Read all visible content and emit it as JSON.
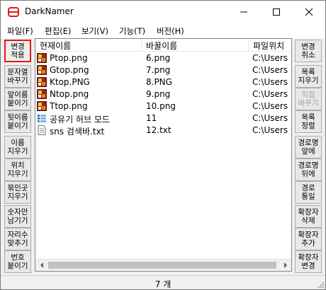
{
  "window": {
    "title": "DarkNamer"
  },
  "menu": [
    {
      "label": "파일(F)"
    },
    {
      "label": "편집(E)"
    },
    {
      "label": "보기(V)"
    },
    {
      "label": "기능(T)"
    },
    {
      "label": "버전(H)"
    }
  ],
  "left_buttons": [
    {
      "label": "변경\n적용"
    },
    {
      "label": "문자열\n바꾸기"
    },
    {
      "label": "앞이름\n붙이기"
    },
    {
      "label": "뒷이름\n붙이기"
    },
    {
      "label": "이름\n지우기"
    },
    {
      "label": "위치\n지우기"
    },
    {
      "label": "묶인곳\n지우기"
    },
    {
      "label": "숫자만\n남기기"
    },
    {
      "label": "자리수\n맞추기"
    },
    {
      "label": "번호\n붙이기"
    }
  ],
  "right_buttons": [
    {
      "label": "변경\n취소"
    },
    {
      "label": "목록\n지우기"
    },
    {
      "label": "직접\n바꾸기"
    },
    {
      "label": "목록\n정렬"
    },
    {
      "label": "경로명\n앞에"
    },
    {
      "label": "경로명\n뒤에"
    },
    {
      "label": "경로\n통일"
    },
    {
      "label": "확장자\n삭제"
    },
    {
      "label": "확장자\n추가"
    },
    {
      "label": "확장자\n변경"
    }
  ],
  "table": {
    "columns": [
      "현재이름",
      "바꿀이름",
      "파일위치"
    ],
    "rows": [
      {
        "current": "Ptop.png",
        "new": "6.png",
        "location": "C:\\Users",
        "icon": "image-file-icon"
      },
      {
        "current": "Gtop.png",
        "new": "7.png",
        "location": "C:\\Users",
        "icon": "image-file-icon"
      },
      {
        "current": "Ktop.PNG",
        "new": "8.PNG",
        "location": "C:\\Users",
        "icon": "image-file-icon"
      },
      {
        "current": "Ntop.png",
        "new": "9.png",
        "location": "C:\\Users",
        "icon": "image-file-icon"
      },
      {
        "current": "Ttop.png",
        "new": "10.png",
        "location": "C:\\Users",
        "icon": "image-file-icon"
      },
      {
        "current": "공유기 허브 모드",
        "new": "11",
        "location": "C:\\Users",
        "icon": "shortcut-icon"
      },
      {
        "current": "sns 검색바.txt",
        "new": "12.txt",
        "location": "C:\\Users",
        "icon": "text-file-icon"
      }
    ]
  },
  "status": {
    "count": "7 개"
  },
  "colors": {
    "focus_border": "#e8141b",
    "app_icon": "#e8141b"
  }
}
